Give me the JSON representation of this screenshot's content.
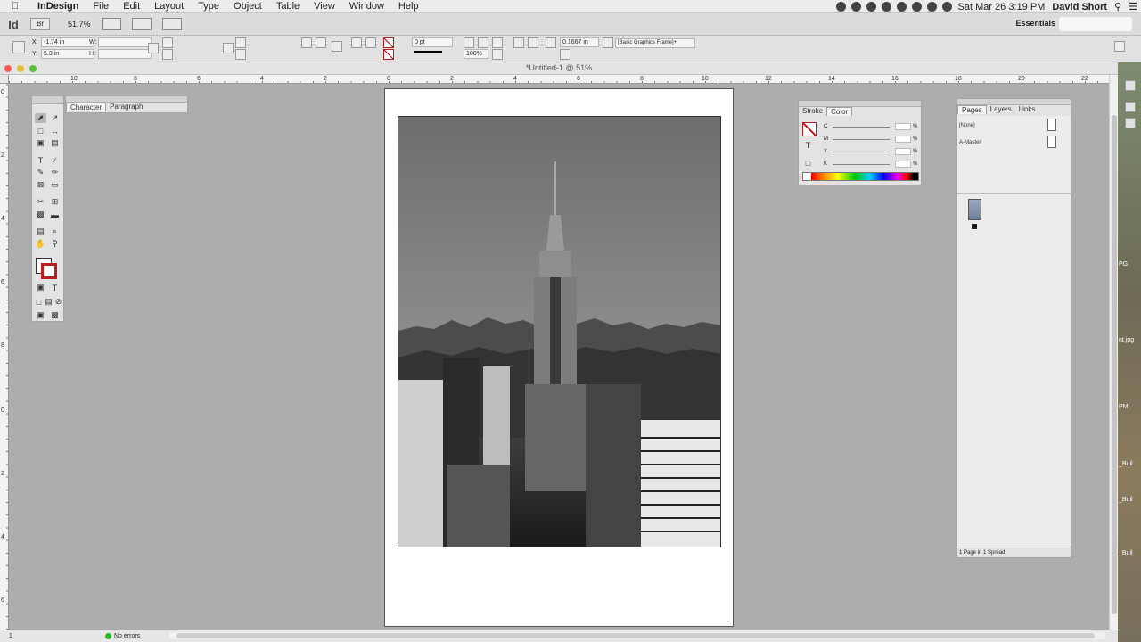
{
  "menubar": {
    "app_name": "InDesign",
    "menus": [
      "File",
      "Edit",
      "Layout",
      "Type",
      "Object",
      "Table",
      "View",
      "Window",
      "Help"
    ],
    "datetime": "Sat Mar 26  3:19 PM",
    "user": "David Short"
  },
  "appbar": {
    "logo": "Id",
    "bridge": "Br",
    "zoom": "51.7%",
    "workspace": "Essentials"
  },
  "control_panel": {
    "x_label": "X:",
    "x_value": "-1.74 in",
    "y_label": "Y:",
    "y_value": "5.3 in",
    "w_label": "W:",
    "h_label": "H:",
    "stroke_weight": "0 pt",
    "opacity": "100%",
    "frame_value": "0.1667 in",
    "object_style": "[Basic Graphics Frame]+"
  },
  "document": {
    "title": "*Untitled-1 @ 51%",
    "ruler_h": [
      "10",
      "8",
      "6",
      "4",
      "2",
      "0",
      "2",
      "4",
      "6",
      "8",
      "10",
      "12",
      "14",
      "16",
      "18",
      "20",
      "22"
    ],
    "ruler_v": [
      "0",
      "2",
      "4",
      "6",
      "8",
      "0",
      "2",
      "4",
      "6"
    ]
  },
  "status": {
    "page": "1",
    "errors": "No errors"
  },
  "character_panel": {
    "tabs": [
      "Character",
      "Paragraph"
    ]
  },
  "color_panel": {
    "tabs": [
      "Stroke",
      "Color"
    ],
    "channels": [
      "C",
      "M",
      "Y",
      "K"
    ],
    "pct": "%"
  },
  "pages_panel": {
    "tabs": [
      "Pages",
      "Layers",
      "Links"
    ],
    "masters": [
      "[None]",
      "A-Master"
    ],
    "footer": "1 Page in 1 Spread"
  },
  "desktop": {
    "labels": [
      "PG",
      "nt.jpg",
      "PM",
      "_Buil",
      "_Buil",
      "_Buil"
    ]
  }
}
